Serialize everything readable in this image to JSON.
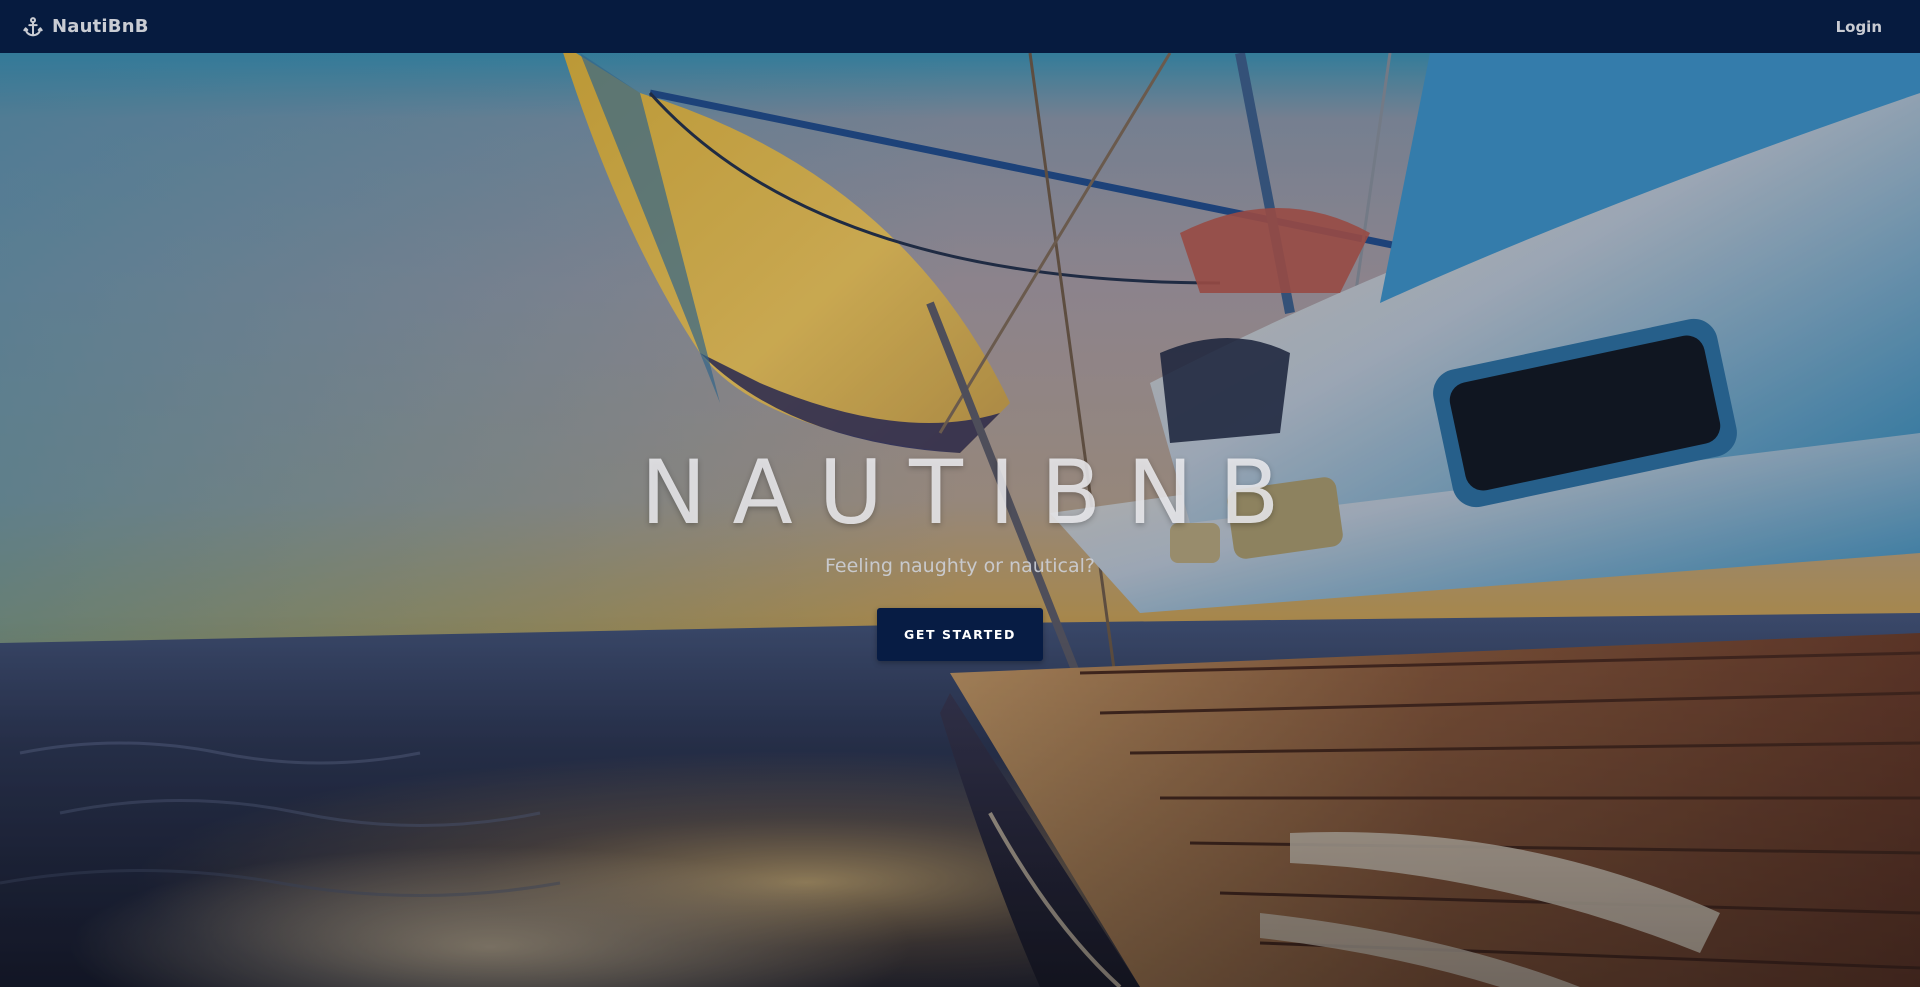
{
  "nav": {
    "brand_label": "NautiBnB",
    "brand_icon": "anchor-icon",
    "login_label": "Login"
  },
  "hero": {
    "title": "NAUTIBNB",
    "subtitle": "Feeling naughty or nautical?",
    "cta_label": "GET STARTED"
  },
  "colors": {
    "navbar_bg": "#061b3f",
    "nav_text": "#c9ccd3",
    "cta_bg": "#071c44",
    "cta_text": "#ffffff"
  }
}
